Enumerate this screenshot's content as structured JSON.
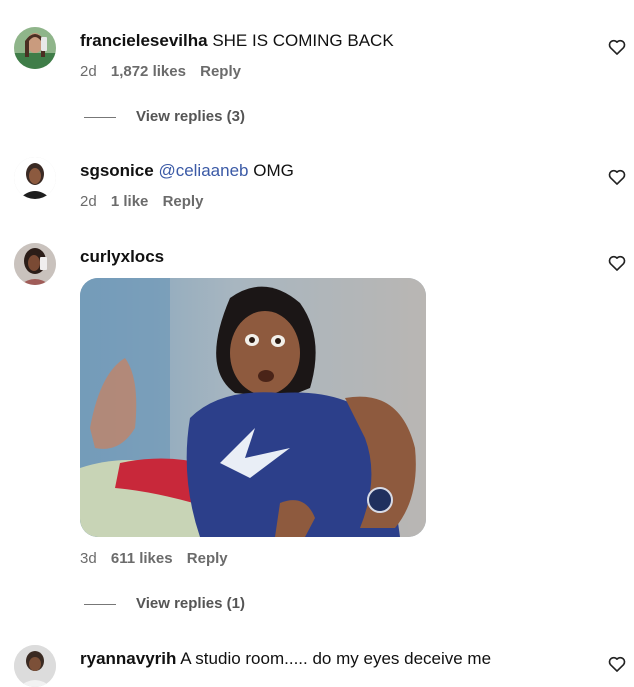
{
  "comments": [
    {
      "username": "francielesevilha",
      "text": "SHE IS COMING BACK",
      "time": "2d",
      "likes": "1,872 likes",
      "reply": "Reply",
      "view_replies": "View replies (3)"
    },
    {
      "username": "sgsonice",
      "mention": "@celiaaneb",
      "text": "OMG",
      "time": "2d",
      "likes": "1 like",
      "reply": "Reply"
    },
    {
      "username": "curlyxlocs",
      "time": "3d",
      "likes": "611 likes",
      "reply": "Reply",
      "view_replies": "View replies (1)"
    },
    {
      "username": "ryannavyrih",
      "text": "A studio room..... do my eyes deceive me"
    }
  ],
  "colors": {
    "mention": "#3b5aa6",
    "meta_text": "#6b6b6b"
  },
  "icons": {
    "like": "heart-outline-icon"
  }
}
